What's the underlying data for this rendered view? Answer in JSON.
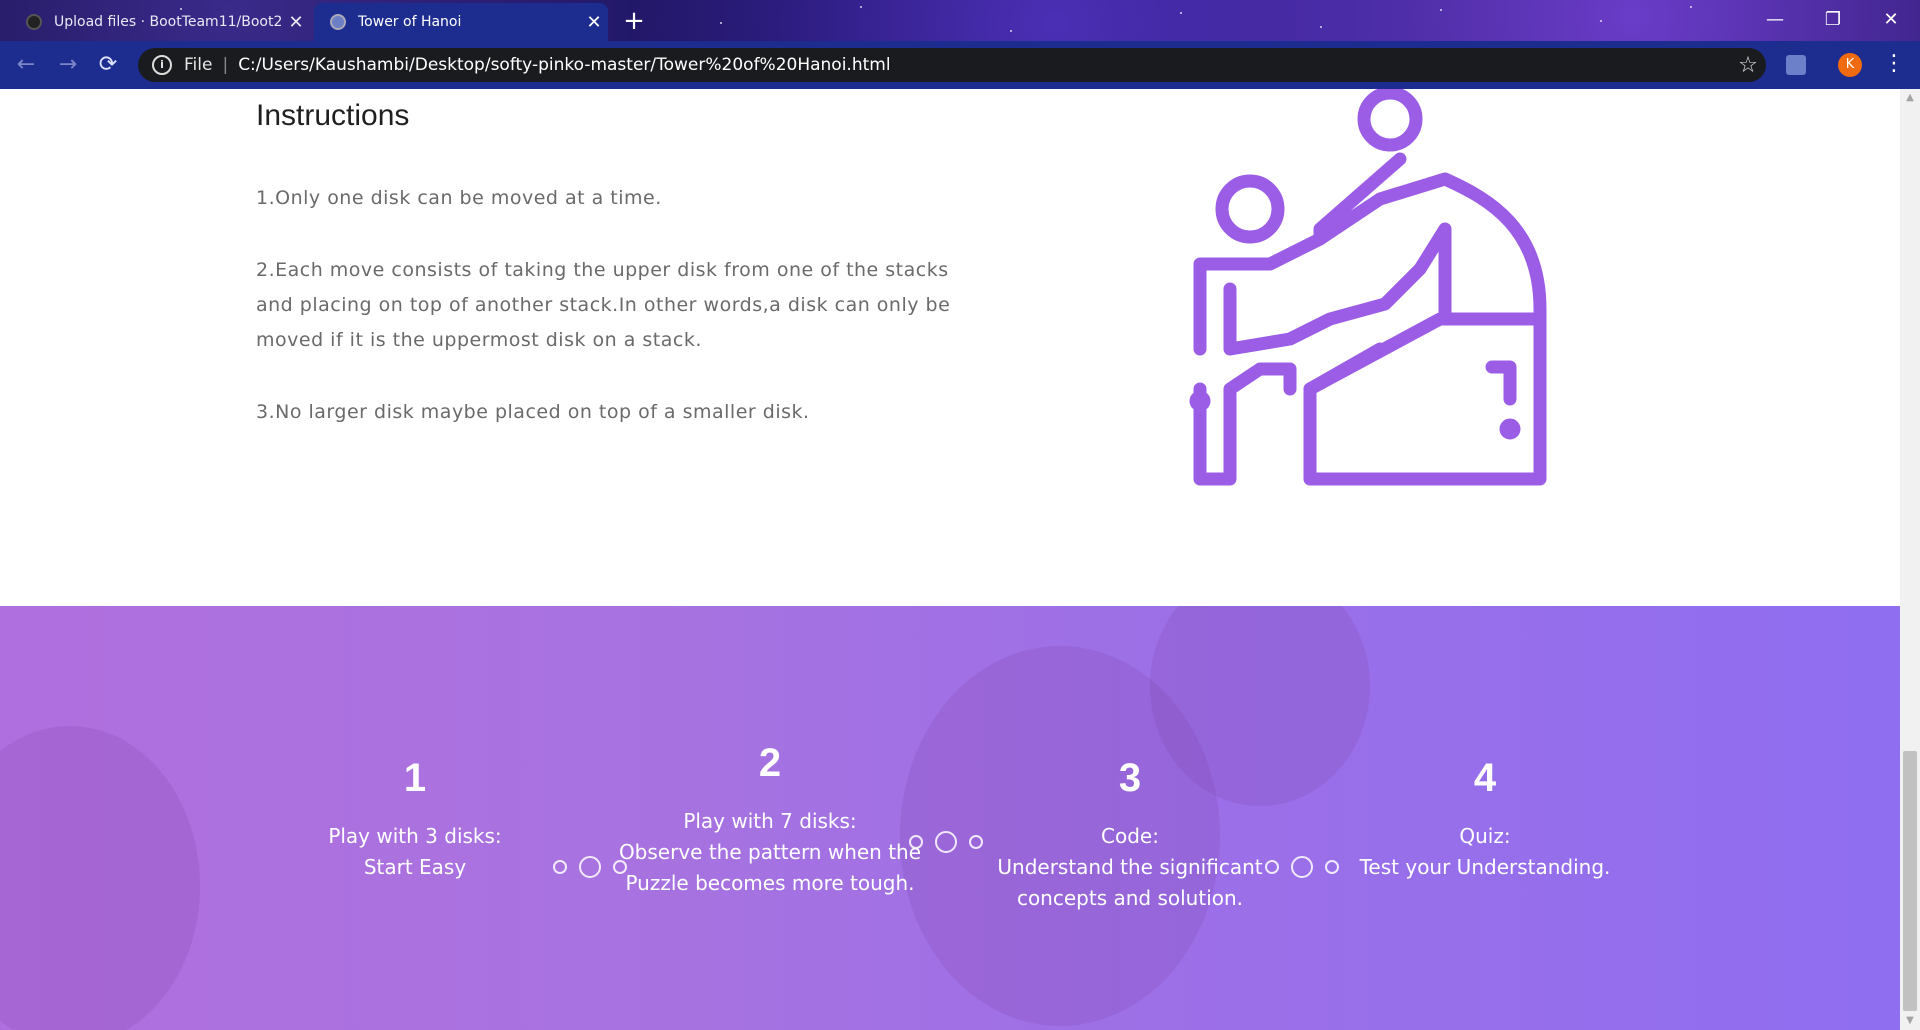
{
  "browser": {
    "tabs": [
      {
        "title": "Upload files · BootTeam11/Boot2",
        "active": false
      },
      {
        "title": "Tower of Hanoi",
        "active": true
      }
    ],
    "address": {
      "scheme_label": "File",
      "url": "C:/Users/Kaushambi/Desktop/softy-pinko-master/Tower%20of%20Hanoi.html"
    },
    "profile_initial": "K",
    "icons": {
      "back": "arrow-left-icon",
      "forward": "arrow-right-icon",
      "reload": "reload-icon",
      "info": "info-icon",
      "bookmark": "star-icon",
      "extension": "extension-icon",
      "menu": "kebab-menu-icon",
      "new_tab": "plus-icon",
      "close_tab": "close-icon",
      "minimize": "minimize-icon",
      "restore": "restore-icon",
      "close_window": "close-icon"
    }
  },
  "instructions": {
    "title": "Instructions",
    "rules": [
      "1.Only one disk can be moved at a time.",
      "2.Each move consists of taking the upper disk from one of the stacks and placing on top of another stack.In other words,a disk can only be moved if it is the uppermost disk on a stack.",
      "3.No larger disk maybe placed on top of a smaller disk."
    ],
    "illustration": "climbing-help-icon",
    "illustration_color": "#9b5de5"
  },
  "steps": [
    {
      "number": "1",
      "lines": [
        "Play with 3 disks:",
        "Start Easy"
      ]
    },
    {
      "number": "2",
      "lines": [
        "Play with 7 disks:",
        "Observe the pattern when the",
        "Puzzle becomes more tough."
      ]
    },
    {
      "number": "3",
      "lines": [
        "Code:",
        "Understand the significant",
        "concepts and solution."
      ]
    },
    {
      "number": "4",
      "lines": [
        "Quiz:",
        "Test your Understanding."
      ]
    }
  ],
  "colors": {
    "chrome_blue": "#1d2d8f",
    "section_gradient_start": "#b06fde",
    "section_gradient_end": "#8f6ef0"
  }
}
